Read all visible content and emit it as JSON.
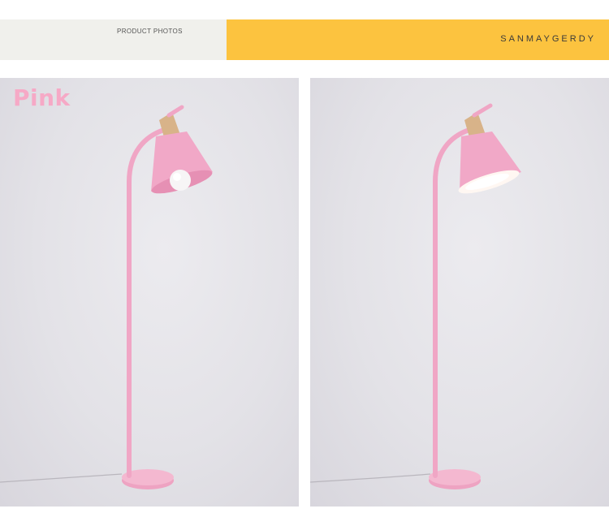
{
  "banner": {
    "section_title": "PRODUCT PHOTOS",
    "section_description": "",
    "brand_name": "SANMAYGERDY",
    "colors": {
      "left_bg": "#f0f0ec",
      "right_bg": "#fcc33f"
    }
  },
  "photos": [
    {
      "color_label": "Pink",
      "lamp_color": "#f1a8c7",
      "bulb": "bare bulb visible"
    },
    {
      "color_label": "",
      "lamp_color": "#f1a8c7",
      "bulb": "lit shade"
    }
  ],
  "colors": {
    "label_pink": "#f6a9c6",
    "backdrop": "#e3e2e7",
    "wood": "#d8b389"
  }
}
